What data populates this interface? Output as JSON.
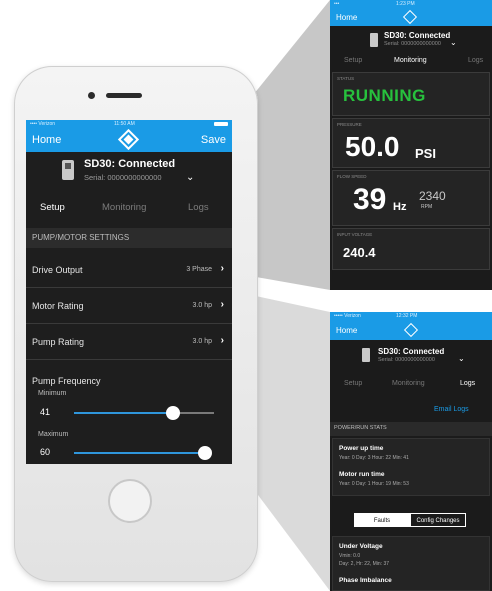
{
  "phone": {
    "status": {
      "carrier": "•••• Verizon",
      "time": "11:50 AM"
    },
    "nav": {
      "home": "Home",
      "save": "Save"
    },
    "device": {
      "title": "SD30: Connected",
      "serial": "Serial: 0000000000000"
    },
    "tabs": [
      "Setup",
      "Monitoring",
      "Logs"
    ],
    "section_title": "PUMP/MOTOR SETTINGS",
    "rows": [
      {
        "label": "Drive Output",
        "value": "3 Phase"
      },
      {
        "label": "Motor Rating",
        "value": "3.0 hp"
      },
      {
        "label": "Pump Rating",
        "value": "3.0 hp"
      }
    ],
    "frequency": {
      "title": "Pump Frequency",
      "minimum_label": "Minimum",
      "minimum_value": "41",
      "maximum_label": "Maximum",
      "maximum_value": "60"
    }
  },
  "monitor_panel": {
    "status": {
      "carrier": "•••",
      "time": "1:23 PM"
    },
    "nav": {
      "home": "Home"
    },
    "device": {
      "title": "SD30: Connected",
      "serial": "Serial: 0000000000000"
    },
    "tabs": [
      "Setup",
      "Monitoring",
      "Logs"
    ],
    "status_label": "STATUS",
    "status_value": "RUNNING",
    "pressure_label": "PRESSURE",
    "pressure_value": "50.0",
    "pressure_unit": "PSI",
    "flow_label": "FLOW SPEED",
    "flow_value": "39",
    "flow_unit": "Hz",
    "rpm_value": "2340",
    "rpm_unit": "RPM",
    "voltage_label": "INPUT VOLTAGE",
    "voltage_value": "240.4"
  },
  "logs_panel": {
    "status": {
      "carrier": "••••• Verizon",
      "time": "12:32 PM"
    },
    "nav": {
      "home": "Home"
    },
    "device": {
      "title": "SD30: Connected",
      "serial": "Serial: 0000000000000"
    },
    "tabs": [
      "Setup",
      "Monitoring",
      "Logs"
    ],
    "email_logs": "Email Logs",
    "section_title": "POWER/RUN STATS",
    "power_up_title": "Power up time",
    "power_up_value": "Year: 0   Day: 3   Hour: 22   Min: 41",
    "motor_run_title": "Motor run time",
    "motor_run_value": "Year: 0   Day: 1   Hour: 19   Min: 53",
    "segment": [
      "Faults",
      "Config Changes"
    ],
    "fault1_title": "Under Voltage",
    "fault1_line1": "Vmin: 0.0",
    "fault1_line2": "Day: 2, Hr: 22, Min: 37",
    "fault2_title": "Phase Imbalance"
  }
}
